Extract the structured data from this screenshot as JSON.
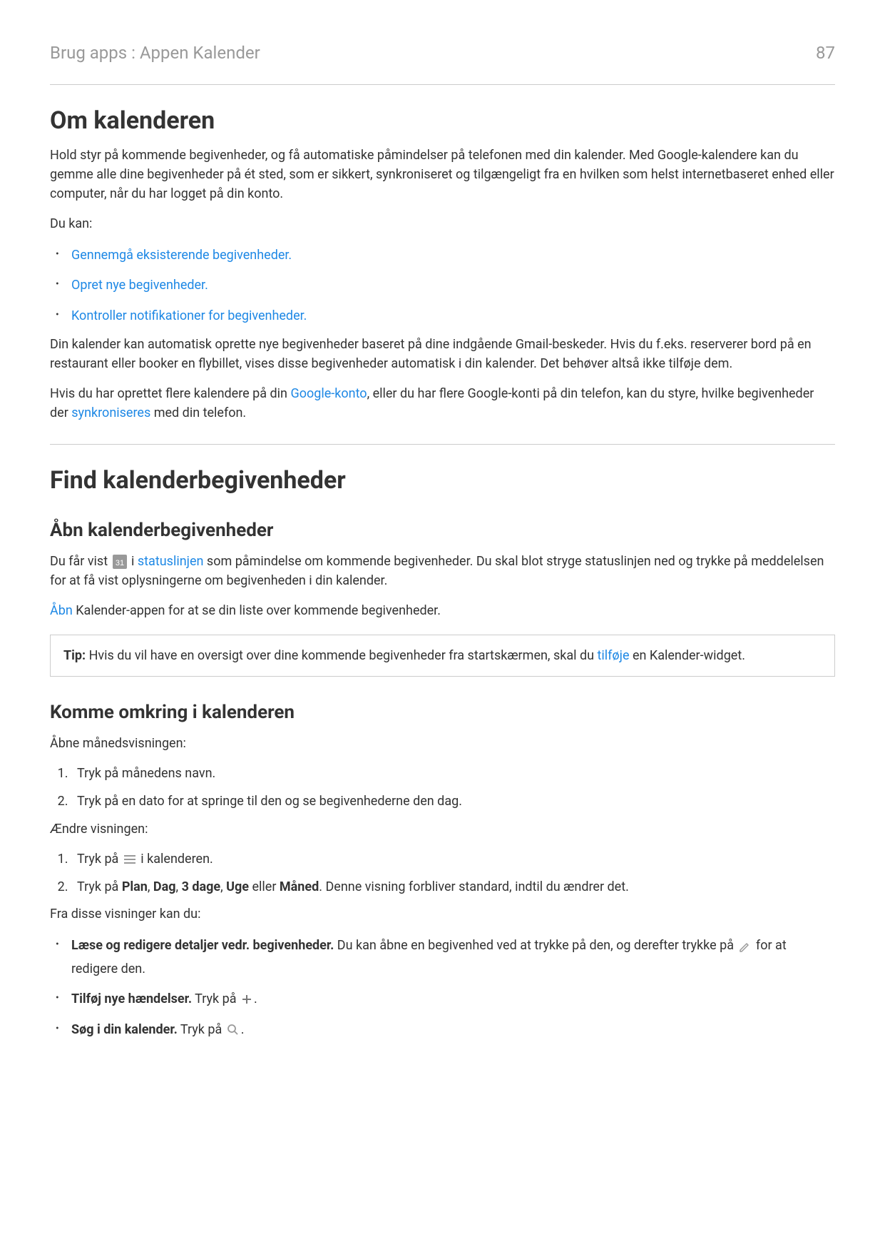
{
  "header": {
    "breadcrumb": "Brug apps : Appen Kalender",
    "page_number": "87"
  },
  "section1": {
    "title": "Om kalenderen",
    "intro": "Hold styr på kommende begivenheder, og få automatiske påmindelser på telefonen med din kalender. Med Google-kalendere kan du gemme alle dine begivenheder på ét sted, som er sikkert, synkroniseret og tilgængeligt fra en hvilken som helst internetbaseret enhed eller computer, når du har logget på din konto.",
    "you_can": "Du kan:",
    "bullets": {
      "b1": "Gennemgå eksisterende begivenheder.",
      "b2": "Opret nye begivenheder.",
      "b3": "Kontroller notifikationer for begivenheder."
    },
    "para2": "Din kalender kan automatisk oprette nye begivenheder baseret på dine indgående Gmail-beskeder. Hvis du f.eks. reserverer bord på en restaurant eller booker en flybillet, vises disse begivenheder automatisk i din kalender. Det behøver altså ikke tilføje dem.",
    "para3_pre": "Hvis du har oprettet flere kalendere på din ",
    "para3_link1": "Google-konto",
    "para3_mid": ", eller du har flere Google-konti på din telefon, kan du styre, hvilke begivenheder der ",
    "para3_link2": "synkroniseres",
    "para3_post": " med din telefon."
  },
  "section2": {
    "title": "Find kalenderbegivenheder",
    "sub1": {
      "title": "Åbn kalenderbegivenheder",
      "p1_pre": "Du får vist ",
      "p1_mid1": " i ",
      "p1_link": "statuslinjen",
      "p1_post": " som påmindelse om kommende begivenheder. Du skal blot stryge statuslinjen ned og trykke på meddelelsen for at få vist oplysningerne om begivenheden i din kalender.",
      "p2_link": "Åbn",
      "p2_post": " Kalender-appen for at se din liste over kommende begivenheder.",
      "callout_label": "Tip:",
      "callout_pre": " Hvis du vil have en oversigt over dine kommende begivenheder fra startskærmen, skal du ",
      "callout_link": "tilføje",
      "callout_post": " en Kalender-widget."
    },
    "sub2": {
      "title": "Komme omkring i kalenderen",
      "p1": "Åbne månedsvisningen:",
      "ol1": {
        "i1": "Tryk på månedens navn.",
        "i2": "Tryk på en dato for at springe til den og se begivenhederne den dag."
      },
      "p2": "Ændre visningen:",
      "ol2": {
        "i1_pre": "Tryk på ",
        "i1_post": " i kalenderen.",
        "i2_pre": "Tryk på ",
        "i2_b1": "Plan",
        "i2_s1": ", ",
        "i2_b2": "Dag",
        "i2_s2": ", ",
        "i2_b3": "3 dage",
        "i2_s3": ", ",
        "i2_b4": "Uge",
        "i2_s4": " eller ",
        "i2_b5": "Måned",
        "i2_post": ". Denne visning forbliver standard, indtil du ændrer det."
      },
      "p3": "Fra disse visninger kan du:",
      "bullets": {
        "b1_strong": "Læse og redigere detaljer vedr. begivenheder.",
        "b1_text1": " Du kan åbne en begivenhed ved at trykke på den, og derefter trykke på ",
        "b1_text2": " for at redigere den.",
        "b2_strong": "Tilføj nye hændelser.",
        "b2_text1": " Tryk på ",
        "b2_text2": ".",
        "b3_strong": "Søg i din kalender.",
        "b3_text1": " Tryk på ",
        "b3_text2": "."
      }
    }
  }
}
